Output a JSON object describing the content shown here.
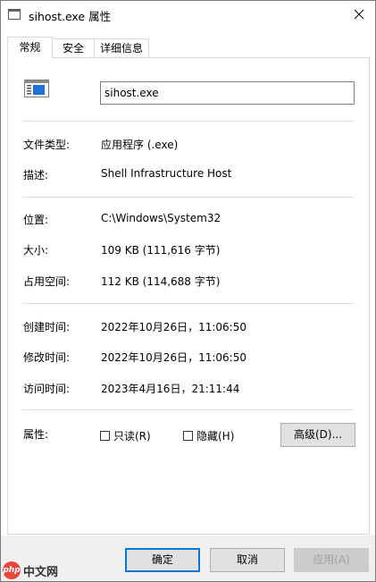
{
  "window": {
    "title": "sihost.exe 属性",
    "close_glyph": "✕"
  },
  "tabs": [
    {
      "label": "常规",
      "active": true
    },
    {
      "label": "安全",
      "active": false
    },
    {
      "label": "详细信息",
      "active": false
    }
  ],
  "general": {
    "filename": "sihost.exe",
    "file_type_label": "文件类型:",
    "file_type_value": "应用程序 (.exe)",
    "description_label": "描述:",
    "description_value": "Shell Infrastructure Host",
    "location_label": "位置:",
    "location_value": "C:\\Windows\\System32",
    "size_label": "大小:",
    "size_value": "109 KB (111,616 字节)",
    "size_on_disk_label": "占用空间:",
    "size_on_disk_value": "112 KB (114,688 字节)",
    "created_label": "创建时间:",
    "created_value": "2022年10月26日，11:06:50",
    "modified_label": "修改时间:",
    "modified_value": "2022年10月26日，11:06:50",
    "accessed_label": "访问时间:",
    "accessed_value": "2023年4月16日，21:11:44",
    "attributes_label": "属性:",
    "readonly_label": "只读(R)",
    "readonly_checked": false,
    "hidden_label": "隐藏(H)",
    "hidden_checked": false,
    "advanced_button": "高级(D)..."
  },
  "footer": {
    "ok_button": "确定",
    "cancel_button": "取消",
    "apply_button": "应用(A)",
    "apply_disabled": true
  },
  "watermark": {
    "logo_text": "php",
    "text": "中文网"
  },
  "colors": {
    "accent": "#0078d7",
    "icon_blue": "#1e73d9",
    "button_bg": "#e1e1e1",
    "footer_bg": "#f0f0f0"
  }
}
